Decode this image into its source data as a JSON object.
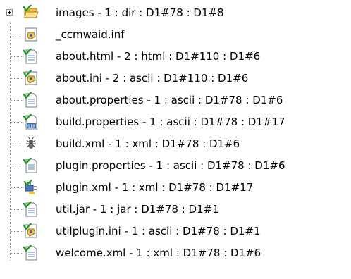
{
  "tree": {
    "items": [
      {
        "label": "images - 1 : dir : D1#78 : D1#8",
        "icon": "folder-icon",
        "expandable": true
      },
      {
        "label": "_ccmwaid.inf",
        "icon": "ini-file-icon"
      },
      {
        "label": "about.html - 2 : html : D1#110 : D1#6",
        "icon": "text-file-icon"
      },
      {
        "label": "about.ini - 2 : ascii : D1#110 : D1#6",
        "icon": "ini-file-icon"
      },
      {
        "label": "about.properties - 1 : ascii : D1#78 : D1#6",
        "icon": "text-file-icon"
      },
      {
        "label": "build.properties - 1 : ascii : D1#78 : D1#17",
        "icon": "binary-properties-icon"
      },
      {
        "label": "build.xml - 1 : xml : D1#78 : D1#6",
        "icon": "ant-build-icon"
      },
      {
        "label": "plugin.properties - 1 : ascii : D1#78 : D1#6",
        "icon": "text-file-icon"
      },
      {
        "label": "plugin.xml - 1 : xml : D1#78 : D1#17",
        "icon": "plugin-xml-icon"
      },
      {
        "label": "util.jar - 1 : jar : D1#78 : D1#1",
        "icon": "text-file-icon"
      },
      {
        "label": "utilplugin.ini - 1 : ascii : D1#78 : D1#1",
        "icon": "ini-file-icon"
      },
      {
        "label": "welcome.xml - 1 : xml : D1#78 : D1#6",
        "icon": "text-file-icon"
      }
    ]
  },
  "colors": {
    "checkmark": "#1a9a1a",
    "folder": "#f0c040",
    "doc_lines": "#5a8ab8",
    "ini_yellow": "#f5c34a"
  }
}
